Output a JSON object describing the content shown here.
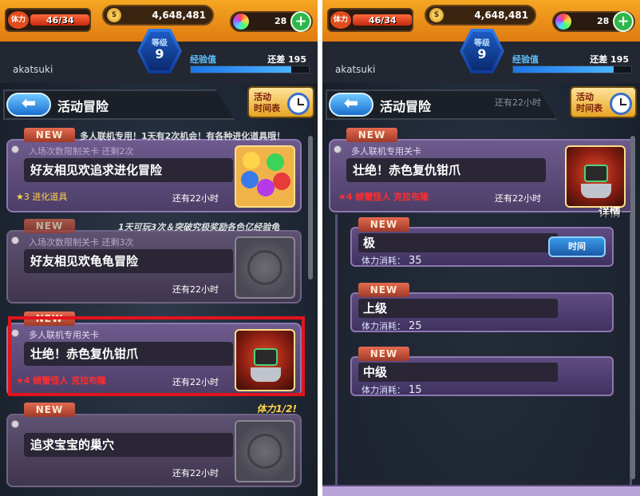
{
  "hud": {
    "stamina_label": "体力",
    "stamina_value": "46/34",
    "stamina_fill_fraction": 1.0,
    "coins": "4,648,481",
    "gems": "28",
    "gem_plus": "+",
    "rank_label": "等级",
    "rank_value": "9",
    "username": "akatsuki",
    "exp_label": "经验值",
    "exp_remaining": "还差 195",
    "exp_fill_fraction": 0.85
  },
  "titlebar": {
    "back_arrow": "⬅",
    "title": "活动冒险",
    "schedule_line1": "活动",
    "schedule_line2": "时间表"
  },
  "left_cards": [
    {
      "new_label": "NEW",
      "banner": "多人联机专用！1天有2次机会！有各种进化道具哦！",
      "subtitle": "入场次数限制关卡  还剩2次",
      "title": "好友相见欢追求进化冒险",
      "reward": "★3 进化道具",
      "time": "还有22小时"
    },
    {
      "new_label": "NEW",
      "banner": "1天可玩3次＆突破究极奖励各色亿经验龟",
      "subtitle": "入场次数限制关卡  还剩3次",
      "title": "好友相见欢龟龟冒险",
      "reward": "",
      "time": "还有22小时"
    },
    {
      "new_label": "NEW",
      "banner": "",
      "subtitle": "多人联机专用关卡",
      "title": "壮绝！赤色复仇钳爪",
      "reward": "★4 螃蟹怪人 克拉布隆",
      "time": "还有22小时"
    },
    {
      "new_label": "NEW",
      "banner": "",
      "subtitle": "",
      "title": "追求宝宝的巢穴",
      "reward": "",
      "time": "还有22小时"
    }
  ],
  "stamina_half": "体力1/2!",
  "right_card": {
    "new_label": "NEW",
    "subtitle": "多人联机专用关卡",
    "title": "壮绝！赤色复仇钳爪",
    "reward": "★4 螃蟹怪人 克拉布隆",
    "time": "还有22小时",
    "details": "详情",
    "header_partial": "还有22小时"
  },
  "tiers": [
    {
      "new_label": "NEW",
      "name": "极",
      "cost_label": "体力消耗：",
      "cost": "35",
      "time_button": "时间"
    },
    {
      "new_label": "NEW",
      "name": "上级",
      "cost_label": "体力消耗：",
      "cost": "25"
    },
    {
      "new_label": "NEW",
      "name": "中级",
      "cost_label": "体力消耗：",
      "cost": "15"
    }
  ],
  "colors": {
    "highlight_border": "#e0141c",
    "reward_red": "#ff2d2d",
    "reward_yellow": "#ffd34a",
    "accent_blue": "#1a6fd0"
  }
}
